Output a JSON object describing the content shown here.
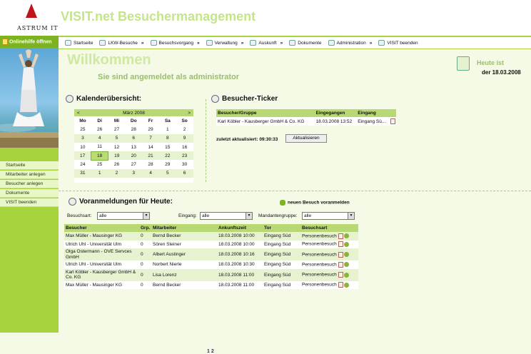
{
  "header": {
    "logo_text": "ASTRUM IT",
    "app_title": "VISIT.net Besuchermanagement"
  },
  "sidebar": {
    "help_label": "Onlinehilfe öffnen",
    "items": [
      "Startseite",
      "Mitarbeiter anlegen",
      "Besucher anlegen",
      "Dokumente",
      "VISIT beenden"
    ]
  },
  "nav": {
    "items": [
      {
        "label": "Startseite",
        "arrow": ""
      },
      {
        "label": "LKW-Besuche",
        "arrow": "»"
      },
      {
        "label": "Besuchsvorgang",
        "arrow": "»"
      },
      {
        "label": "Verwaltung",
        "arrow": "»"
      },
      {
        "label": "Auskunft",
        "arrow": "»"
      },
      {
        "label": "Dokumente",
        "arrow": ""
      },
      {
        "label": "Administration",
        "arrow": "»"
      },
      {
        "label": "VISIT beenden",
        "arrow": ""
      }
    ]
  },
  "main": {
    "welcome": "Willkommen",
    "logged_in": "Sie sind angemeldet als administrator",
    "today_label": "Heute ist",
    "today_date": "der 18.03.2008"
  },
  "calendar": {
    "title": "Kalenderübersicht:",
    "prev": "<",
    "next": ">",
    "month": "März 2008",
    "weekdays": [
      "Mo",
      "Di",
      "Mi",
      "Do",
      "Fr",
      "Sa",
      "So"
    ],
    "weeks": [
      [
        "25",
        "26",
        "27",
        "28",
        "29",
        "1",
        "2"
      ],
      [
        "3",
        "4",
        "5",
        "6",
        "7",
        "8",
        "9"
      ],
      [
        "10",
        "11",
        "12",
        "13",
        "14",
        "15",
        "16"
      ],
      [
        "17",
        "18",
        "19",
        "20",
        "21",
        "22",
        "23"
      ],
      [
        "24",
        "25",
        "26",
        "27",
        "28",
        "29",
        "30"
      ],
      [
        "31",
        "1",
        "2",
        "3",
        "4",
        "5",
        "6"
      ]
    ],
    "today": "18"
  },
  "ticker": {
    "title": "Besucher-Ticker",
    "columns": [
      "Besucher/Gruppe",
      "Eingegangen",
      "Eingang"
    ],
    "rows": [
      [
        "Karl Köbler - Kausberger GmbH & Co. KG",
        "18.03.2008 13:52",
        "Eingang Sü..."
      ]
    ],
    "updated": "zuletzt aktualisiert: 09:30:33",
    "refresh_button": "Aktualisieren"
  },
  "preregistrations": {
    "title": "Voranmeldungen für Heute:",
    "new_visit": "neuen Besuch voranmelden",
    "filters": {
      "besuchsart_label": "Besuchsart:",
      "besuchsart_value": "alle",
      "eingang_label": "Eingang:",
      "eingang_value": "alle",
      "mandanten_label": "Mandantengruppe:",
      "mandanten_value": "alle"
    },
    "columns": [
      "Besucher",
      "Grp.",
      "Mitarbeiter",
      "Ankunftszeit",
      "Tor",
      "Besuchsart"
    ],
    "rows": [
      [
        "Max Müller - Mausinger KG",
        "0",
        "Bernd Becker",
        "18.03.2008 10:00",
        "Eingang Süd",
        "Personenbesuch"
      ],
      [
        "Ulrich Uhl - Universität Ulm",
        "0",
        "Sören Steiner",
        "18.03.2008 10:00",
        "Eingang Süd",
        "Personenbesuch"
      ],
      [
        "Olga Ostermann - OVE Servces GmbH",
        "0",
        "Albert Austinger",
        "18.03.2008 10:16",
        "Eingang Süd",
        "Personenbesuch"
      ],
      [
        "Ulrich Uhl - Universität Ulm",
        "0",
        "Norbert Nierle",
        "18.03.2008 10:30",
        "Eingang Süd",
        "Personenbesuch"
      ],
      [
        "Karl Köbler - Kausberger GmbH & Co. KG",
        "0",
        "Lisa Lorenz",
        "18.03.2008 11:00",
        "Eingang Süd",
        "Personenbesuch"
      ],
      [
        "Max Müller - Mausinger KG",
        "0",
        "Bernd Becker",
        "18.03.2008 11:00",
        "Eingang Süd",
        "Personenbesuch"
      ]
    ],
    "pages": [
      "1",
      "2"
    ]
  },
  "colors": {
    "accent": "#a7d43c",
    "header_green": "#b7d873",
    "row_alt": "#e7f2d1",
    "logo_red": "#c0141c"
  }
}
